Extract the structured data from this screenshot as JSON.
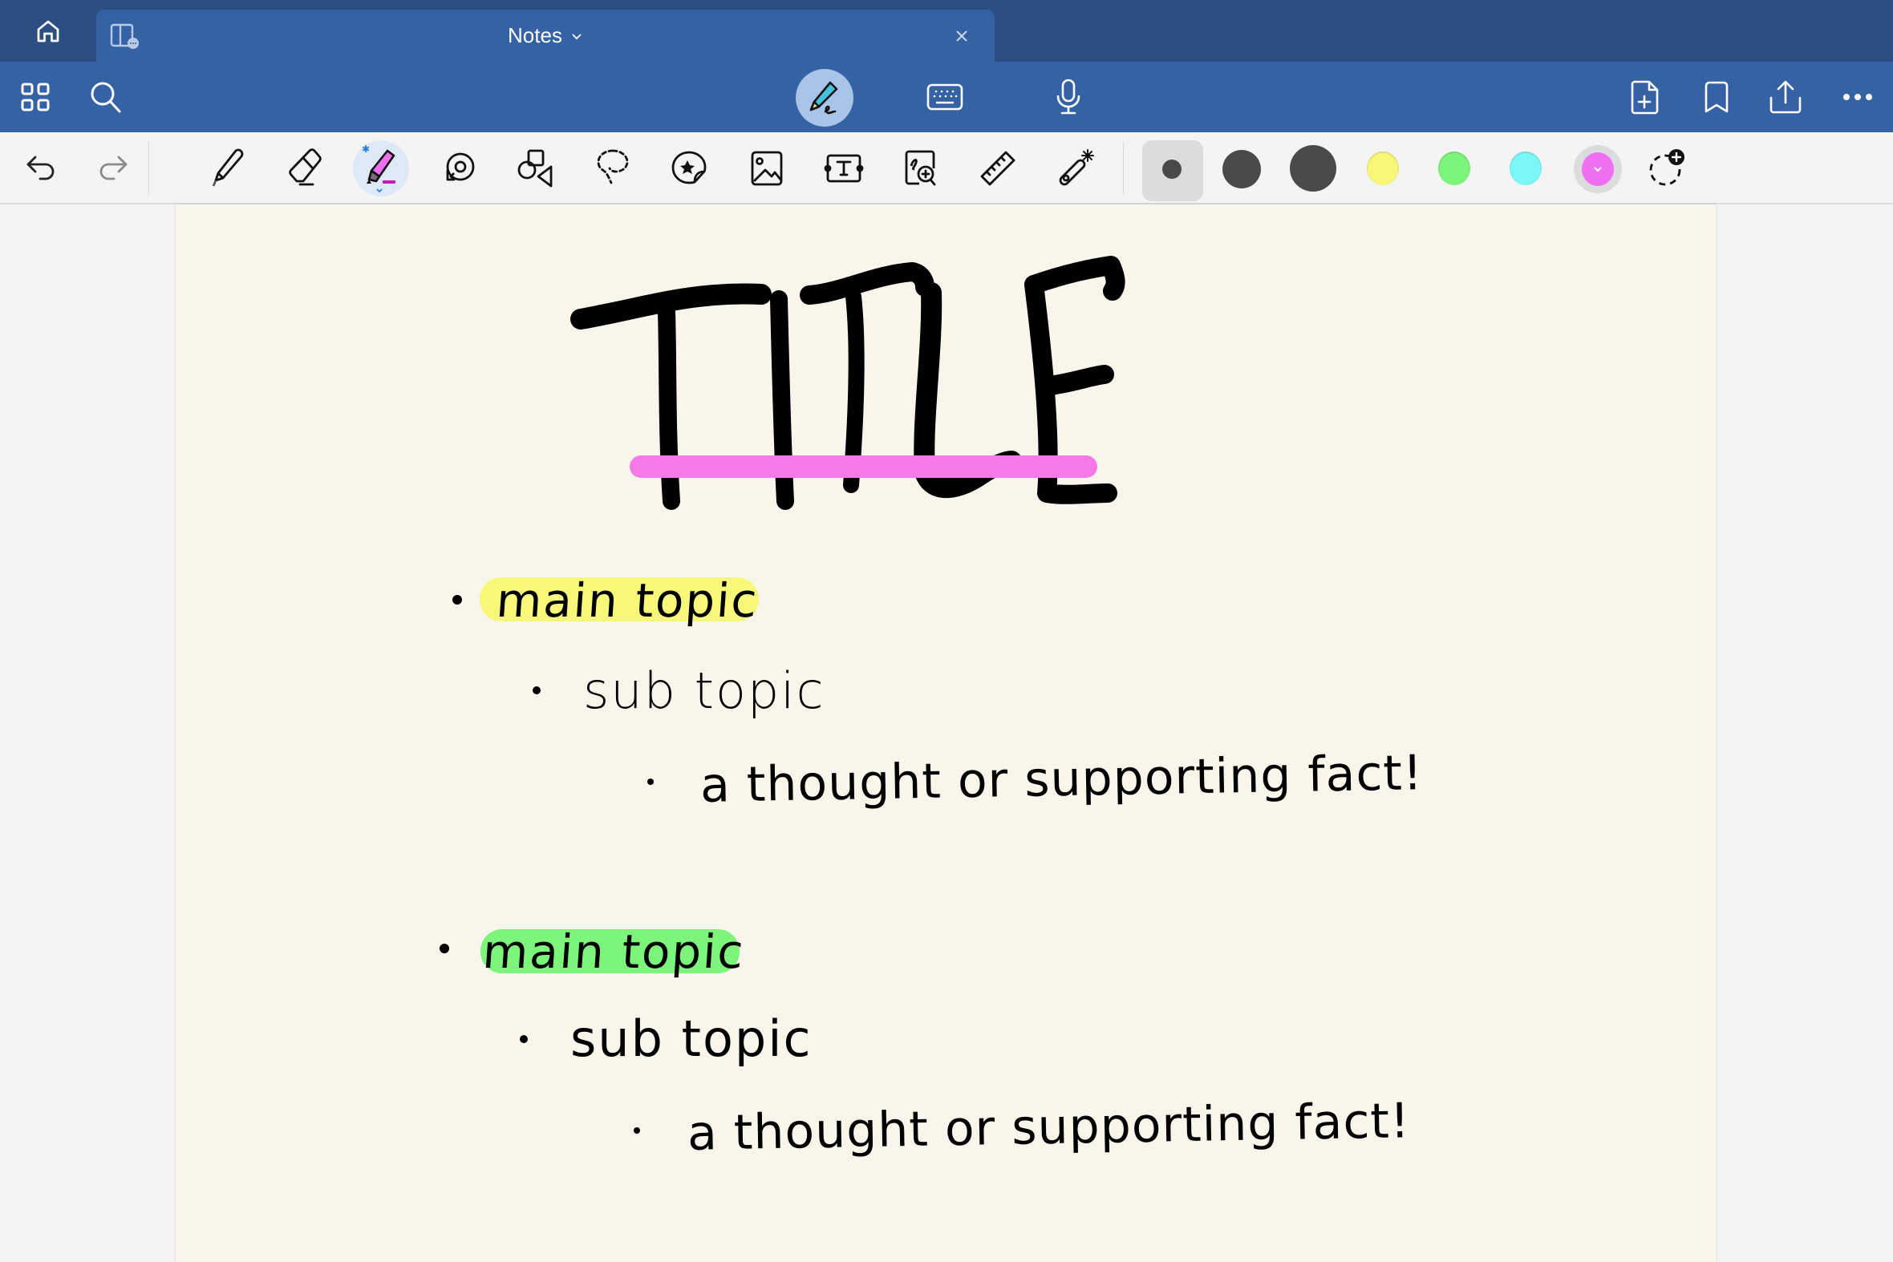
{
  "tabbar": {
    "tab_title": "Notes",
    "icons": [
      "home-icon",
      "split-view-icon",
      "chevron-down-icon",
      "close-icon"
    ]
  },
  "toolbar": {
    "left_icons": [
      "grid-icon",
      "search-icon"
    ],
    "center_modes": [
      "handwriting-mode-icon",
      "keyboard-icon",
      "microphone-icon"
    ],
    "active_mode": "handwriting",
    "right_icons": [
      "add-page-icon",
      "bookmark-icon",
      "share-icon",
      "more-icon"
    ]
  },
  "tools": {
    "items": [
      "undo",
      "redo",
      "pen",
      "eraser",
      "highlighter",
      "tape",
      "shapes",
      "lasso",
      "sticker",
      "image",
      "text-box",
      "zoom-window",
      "ruler",
      "laser-pointer"
    ],
    "active_tool": "highlighter",
    "sizes": [
      "small",
      "medium",
      "large"
    ],
    "active_size": "small",
    "colors": [
      "#f7f77a",
      "#7df57b",
      "#7bf7f7",
      "#ee6fef"
    ],
    "active_color": "#ee6fef",
    "size_color": "#4a4a4a"
  },
  "note": {
    "background": "#f8f6ea",
    "title": "TITLE",
    "title_underline_color": "#f57ae8",
    "outline": [
      {
        "level": 1,
        "text": "main topic",
        "highlight": "#f7f77a"
      },
      {
        "level": 2,
        "text": "sub topic"
      },
      {
        "level": 3,
        "text": "a thought or supporting fact!"
      },
      {
        "level": 1,
        "text": "main topic",
        "highlight": "#7df57b"
      },
      {
        "level": 2,
        "text": "sub topic"
      },
      {
        "level": 3,
        "text": "a thought or supporting fact!"
      }
    ]
  }
}
